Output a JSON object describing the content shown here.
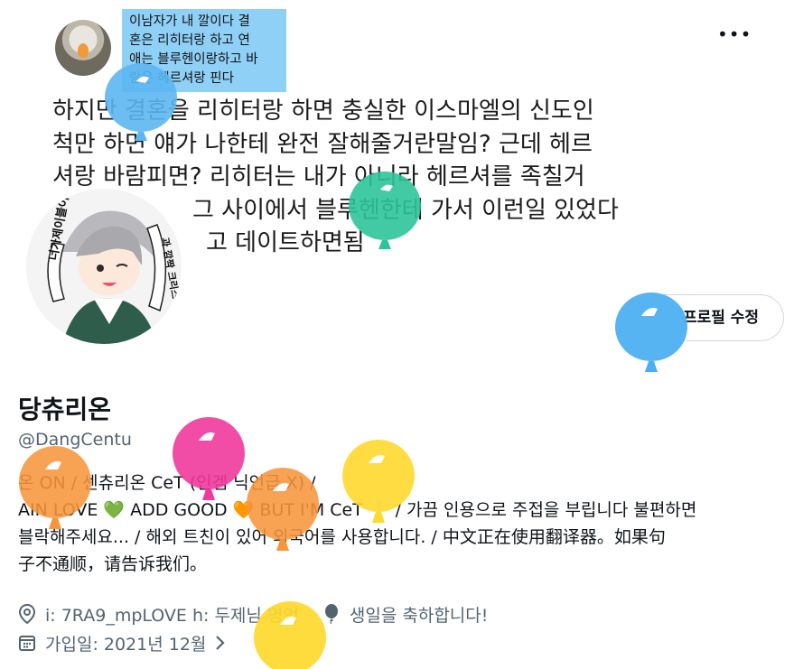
{
  "banner": {
    "highlight_lines": [
      "이남자가 내 깔이다 결",
      "혼은 리히터랑 하고 연",
      "애는 블루헨이랑하고 바",
      "람은 헤르셔랑 핀다"
    ],
    "text_lines": [
      "하지만 결혼을 리히터랑 하면 충실한 이스마엘의 신도인",
      "척만 하면 얘가 나한테 완전 잘해줄거란말임? 근데 헤르",
      "셔랑 바람피면? 리히터는 내가 아니라 헤르셔를 족칠거",
      "그 사이에서 블루헨한테 가서 이런일 있었다",
      "고 데이트하면됨"
    ]
  },
  "more_label": "•••",
  "edit_profile_label": "프로필 수정",
  "profile": {
    "name": "당츄리온",
    "handle": "@DangCentu",
    "bio_lines": [
      "온 ON / 센츄리온 CeT (인겜 닉언급 X) /",
      "AIN LOVE 💚 ADD GOOD 🧡 BUT I'M CeT ❕ / 가끔 인용으로 주접을 부립니다 불편하면",
      "블락해주세요... / 해외 트친이 있어 외국어를 사용합니다. / 中文正在使用翻译器。如果句",
      "子不通顺，请告诉我们。"
    ],
    "location": "i: 7RA9_mpLOVE h: 두제님 명언",
    "birthday": "생일을 축하합니다!",
    "joined": "가입일: 2021년 12월"
  },
  "avatar": {
    "left_text": "너가제이블이",
    "right_text": "과 깜짝 크리스마스다"
  },
  "colors": {
    "accent_blue": "#1d9bf0",
    "text_secondary": "#536471",
    "highlight": "#8fd0f7"
  },
  "icons": [
    "location-icon",
    "balloon-icon",
    "calendar-icon",
    "chevron-right-icon",
    "more-icon"
  ]
}
